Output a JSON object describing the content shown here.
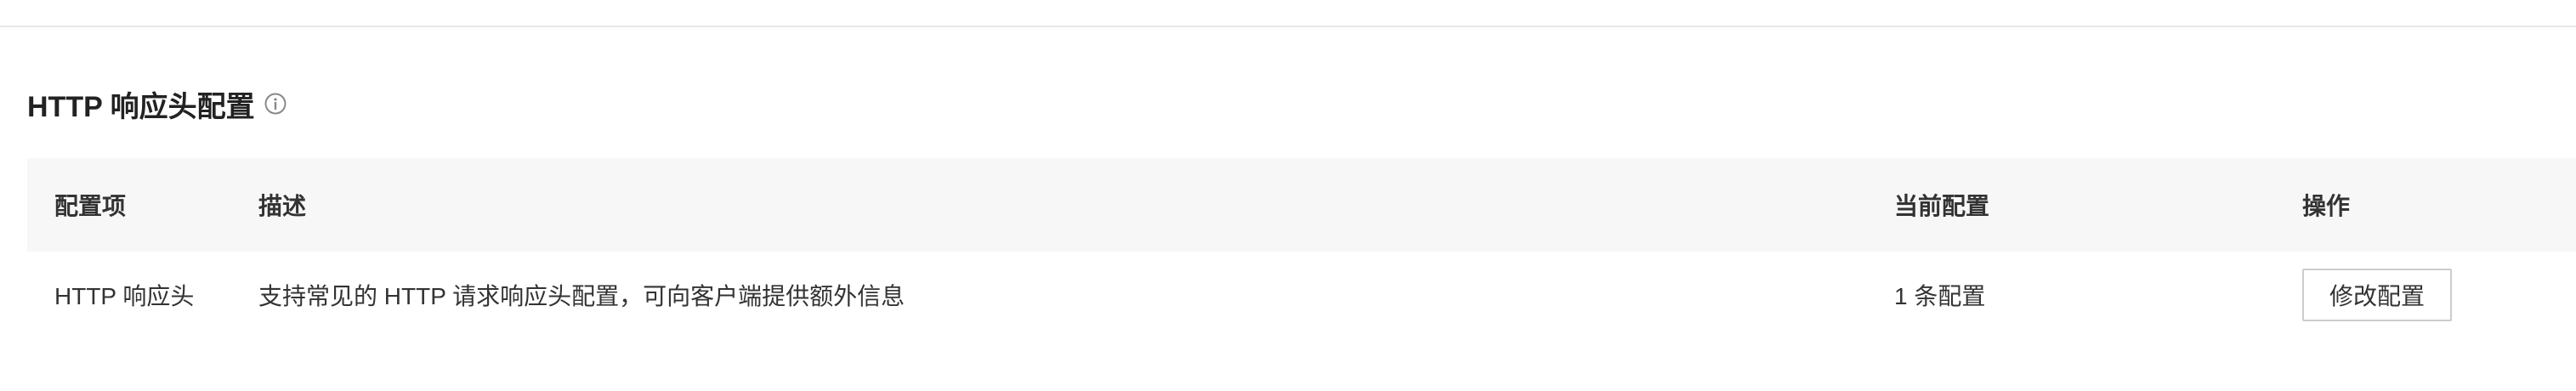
{
  "section": {
    "title": "HTTP 响应头配置",
    "info_icon": "info-circle-icon"
  },
  "table": {
    "columns": [
      "配置项",
      "描述",
      "当前配置",
      "操作"
    ],
    "rows": [
      {
        "item": "HTTP 响应头",
        "description": "支持常见的 HTTP 请求响应头配置，可向客户端提供额外信息",
        "current": "1 条配置",
        "action_label": "修改配置"
      }
    ]
  },
  "colors": {
    "header_bg": "#f7f7f7",
    "divider": "#e6e6e6",
    "button_border": "#cccccc",
    "text": "#333333"
  }
}
